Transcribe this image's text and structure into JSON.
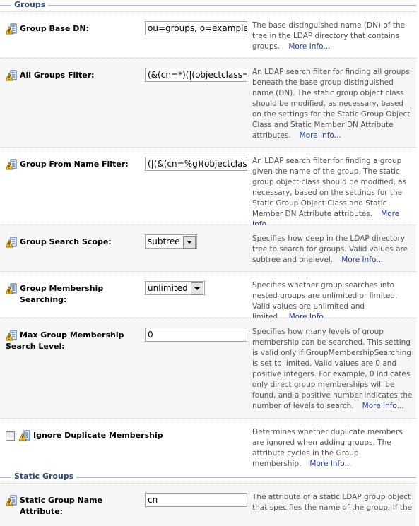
{
  "sections": [
    {
      "title": "Groups"
    },
    {
      "title": "Static Groups"
    }
  ],
  "rows": [
    {
      "label": "Group Base DN:",
      "value": "ou=groups, o=example",
      "desc": "The base distinguished name (DN) of the tree in the LDAP directory that contains groups.",
      "more": "More Info..."
    },
    {
      "label": "All Groups Filter:",
      "value": "(&(cn=*)(|(objectclass=",
      "desc": "An LDAP search filter for finding all groups beneath the base group distinguished name (DN). The static group object class should be modified, as necessary, based on the settings for the Static Group Object Class and Static Member DN Attribute attributes.",
      "more": "More Info..."
    },
    {
      "label": "Group From Name Filter:",
      "value": "(|(&(cn=%g)(objectclas",
      "desc": "An LDAP search filter for finding a group given the name of the group. The static group object class should be modified, as necessary, based on the settings for the Static Group Object Class and Static Member DN Attribute attributes.",
      "more": "More Info..."
    },
    {
      "label": "Group Search Scope:",
      "value": "subtree",
      "desc": "Specifies how deep in the LDAP directory tree to search for groups. Valid values are subtree and onelevel.",
      "more": "More Info..."
    },
    {
      "label": "Group Membership Searching:",
      "value": "unlimited",
      "desc": "Specifies whether group searches into nested groups are unlimited or limited. Valid values are unlimited and limited.",
      "more": "More Info..."
    },
    {
      "label": "Max Group Membership Search Level:",
      "value": "0",
      "desc": "Specifies how many levels of group membership can be searched. This setting is valid only if GroupMembershipSearching is set to limited. Valid values are 0 and positive integers. For example, 0 indicates only direct group memberships will be found, and a positive number indicates the number of levels to search.",
      "more": "More Info..."
    },
    {
      "label": "Ignore Duplicate Membership",
      "checked": false,
      "desc": "Determines whether duplicate members are ignored when adding groups. The attribute cycles in the Group membership.",
      "more": "More Info..."
    },
    {
      "label": "Static Group Name Attribute:",
      "value": "cn",
      "desc": "The attribute of a static LDAP group object that specifies the name of the group. If the"
    }
  ],
  "icons": {
    "row": "warning-config-icon"
  },
  "colors": {
    "link": "#1a3fa0",
    "section": "#2e4b73",
    "alt_row": "#f6f6f6"
  }
}
